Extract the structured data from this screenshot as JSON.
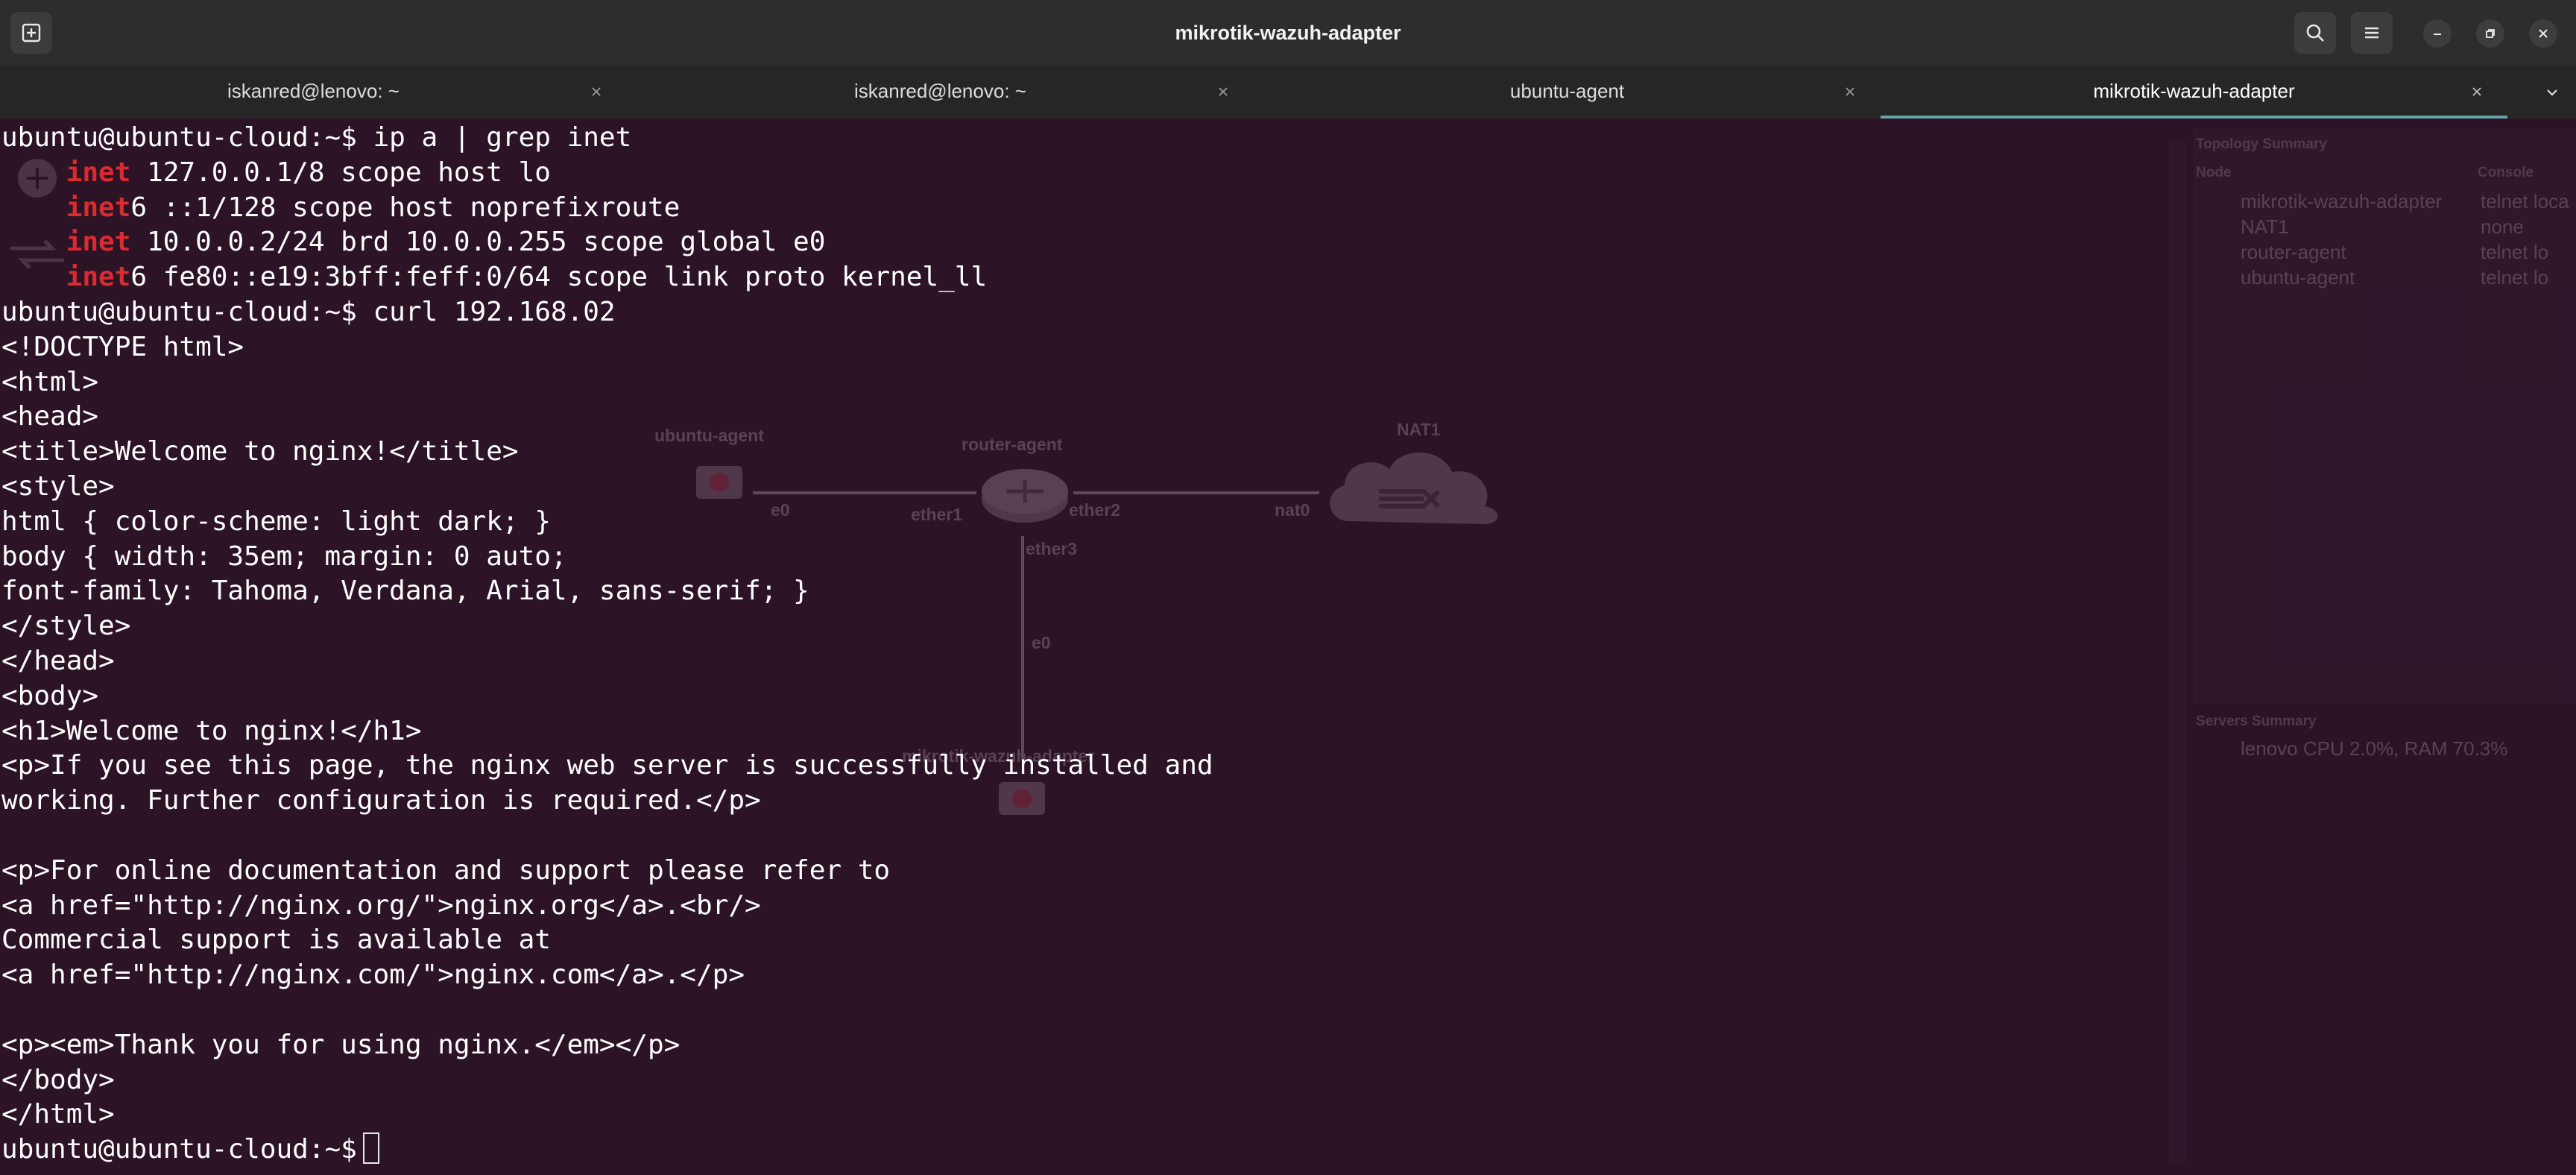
{
  "window": {
    "title": "mikrotik-wazuh-adapter"
  },
  "tabs": [
    {
      "label": "iskanred@lenovo: ~",
      "active": false
    },
    {
      "label": "iskanred@lenovo: ~",
      "active": false
    },
    {
      "label": "ubuntu-agent",
      "active": false
    },
    {
      "label": "mikrotik-wazuh-adapter",
      "active": true
    }
  ],
  "colors": {
    "terminal_background": "#2c1326",
    "headerbar_background": "#2d2d2d",
    "grep_match": "#d92b30",
    "active_tab_indicator": "#64a0a5"
  },
  "terminal": {
    "prompt": "ubuntu@ubuntu-cloud:~$",
    "lines": [
      {
        "kind": "cmd",
        "prompt": "ubuntu@ubuntu-cloud:~$",
        "text": " ip a | grep inet"
      },
      {
        "kind": "match",
        "indent": "    ",
        "match": "inet",
        "rest": " 127.0.0.1/8 scope host lo"
      },
      {
        "kind": "match",
        "indent": "    ",
        "match": "inet",
        "rest": "6 ::1/128 scope host noprefixroute"
      },
      {
        "kind": "match",
        "indent": "    ",
        "match": "inet",
        "rest": " 10.0.0.2/24 brd 10.0.0.255 scope global e0"
      },
      {
        "kind": "match",
        "indent": "    ",
        "match": "inet",
        "rest": "6 fe80::e19:3bff:feff:0/64 scope link proto kernel_ll"
      },
      {
        "kind": "cmd",
        "prompt": "ubuntu@ubuntu-cloud:~$",
        "text": " curl 192.168.02"
      },
      {
        "kind": "out",
        "text": "<!DOCTYPE html>"
      },
      {
        "kind": "out",
        "text": "<html>"
      },
      {
        "kind": "out",
        "text": "<head>"
      },
      {
        "kind": "out",
        "text": "<title>Welcome to nginx!</title>"
      },
      {
        "kind": "out",
        "text": "<style>"
      },
      {
        "kind": "out",
        "text": "html { color-scheme: light dark; }"
      },
      {
        "kind": "out",
        "text": "body { width: 35em; margin: 0 auto;"
      },
      {
        "kind": "out",
        "text": "font-family: Tahoma, Verdana, Arial, sans-serif; }"
      },
      {
        "kind": "out",
        "text": "</style>"
      },
      {
        "kind": "out",
        "text": "</head>"
      },
      {
        "kind": "out",
        "text": "<body>"
      },
      {
        "kind": "out",
        "text": "<h1>Welcome to nginx!</h1>"
      },
      {
        "kind": "out",
        "text": "<p>If you see this page, the nginx web server is successfully installed and"
      },
      {
        "kind": "out",
        "text": "working. Further configuration is required.</p>"
      },
      {
        "kind": "out",
        "text": ""
      },
      {
        "kind": "out",
        "text": "<p>For online documentation and support please refer to"
      },
      {
        "kind": "out",
        "text": "<a href=\"http://nginx.org/\">nginx.org</a>.<br/>"
      },
      {
        "kind": "out",
        "text": "Commercial support is available at"
      },
      {
        "kind": "out",
        "text": "<a href=\"http://nginx.com/\">nginx.com</a>.</p>"
      },
      {
        "kind": "out",
        "text": ""
      },
      {
        "kind": "out",
        "text": "<p><em>Thank you for using nginx.</em></p>"
      },
      {
        "kind": "out",
        "text": "</body>"
      },
      {
        "kind": "out",
        "text": "</html>"
      },
      {
        "kind": "prompt",
        "prompt": "ubuntu@ubuntu-cloud:~$",
        "text": ""
      }
    ]
  },
  "background_gns3": {
    "nodes": {
      "ubuntu_agent": "ubuntu-agent",
      "router_agent": "router-agent",
      "nat1": "NAT1",
      "mikrotik": "mikrotik-wazuh-adapter"
    },
    "ports": {
      "e0_a": "e0",
      "ether1": "ether1",
      "ether2": "ether2",
      "nat0": "nat0",
      "ether3": "ether3",
      "e0_b": "e0"
    },
    "topology_summary": {
      "title": "Topology Summary",
      "col_node": "Node",
      "col_console": "Console",
      "rows": [
        {
          "node": "mikrotik-wazuh-adapter",
          "console": "telnet loca"
        },
        {
          "node": "NAT1",
          "console": "none"
        },
        {
          "node": "router-agent",
          "console": "telnet lo"
        },
        {
          "node": "ubuntu-agent",
          "console": "telnet lo"
        }
      ]
    },
    "servers_summary": {
      "title": "Servers Summary",
      "row": "lenovo CPU 2.0%, RAM 70.3%"
    }
  }
}
